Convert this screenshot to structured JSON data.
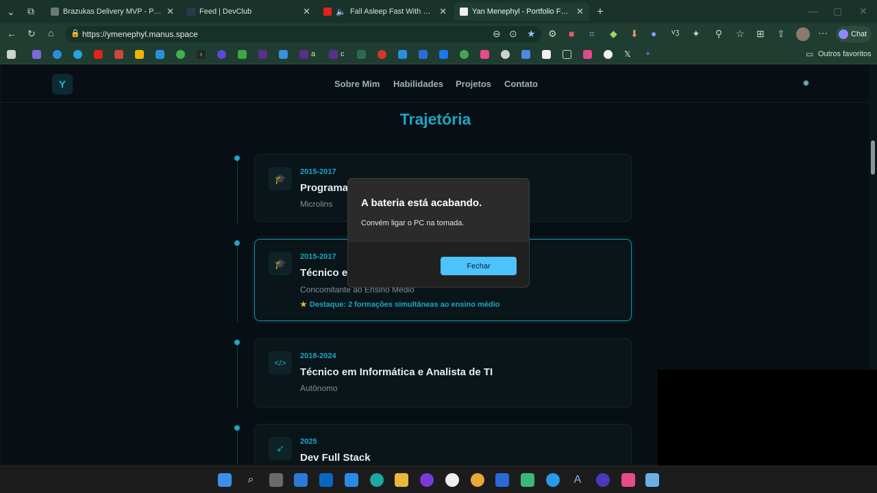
{
  "browser": {
    "tabs": [
      {
        "title": "Brazukas Delivery MVP - Painel de",
        "icon": "cube-icon",
        "color": "#6b7a72"
      },
      {
        "title": "Feed | DevClub",
        "icon": "devclub-icon",
        "color": "#2a3a4a"
      },
      {
        "title": "Fall Asleep Fast With Heavy Ra",
        "icon": "youtube-icon",
        "color": "#e62117"
      },
      {
        "title": "Yan Menephyl - Portfolio Full-Stac",
        "icon": "portfolio-icon",
        "color": "#eeeeee"
      }
    ],
    "url": "https://ymenephyl.manus.space",
    "chat_label": "Chat",
    "other_favorites": "Outros favoritos",
    "bookmark_labels": [
      "a",
      "c"
    ]
  },
  "site": {
    "logo": "Y",
    "nav": [
      "Sobre Mim",
      "Habilidades",
      "Projetos",
      "Contato"
    ],
    "section_title": "Trajetória",
    "timeline": [
      {
        "year": "2015-2017",
        "title": "Programa",
        "subtitle": "Microlins",
        "icon": "graduation-cap-icon",
        "highlight": ""
      },
      {
        "year": "2015-2017",
        "title": "Técnico e",
        "subtitle": "Concomitante ao Ensino Médio",
        "icon": "graduation-cap-icon",
        "highlight": "Destaque: 2 formações simultâneas ao ensino médio"
      },
      {
        "year": "2018-2024",
        "title": "Técnico em Informática e Analista de TI",
        "subtitle": "Autônomo",
        "icon": "code-icon",
        "highlight": ""
      },
      {
        "year": "2025",
        "title": "Dev Full Stack",
        "subtitle": "",
        "icon": "rocket-icon",
        "highlight": ""
      }
    ]
  },
  "dialog": {
    "title": "A bateria está acabando.",
    "message": "Convém ligar o PC na tomada.",
    "button": "Fechar"
  },
  "colors": {
    "accent": "#1aa7c4",
    "dialog_button": "#4cc2ff",
    "browser_chrome": "#203d31"
  }
}
